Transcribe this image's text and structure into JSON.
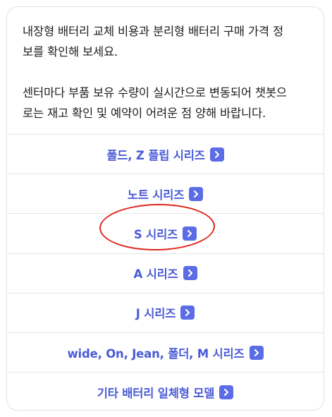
{
  "message": {
    "paragraph_1": "내장형 배터리 교체 비용과 분리형 배터리 구매 가격 정\n보를 확인해 보세요.",
    "paragraph_2": "센터마다 부품 보유 수량이 실시간으로 변동되어 챗봇으\n로는 재고 확인 및 예약이 어려운 점 양해 바랍니다."
  },
  "options": [
    {
      "label": "폴드, Z 플립 시리즈"
    },
    {
      "label": "노트 시리즈"
    },
    {
      "label": "S 시리즈"
    },
    {
      "label": "A 시리즈"
    },
    {
      "label": "J 시리즈"
    },
    {
      "label": "wide, On, Jean, 폴더, M 시리즈"
    },
    {
      "label": "기타 배터리 일체형 모델"
    }
  ],
  "icons": {
    "option_arrow": "chevron-right-icon"
  },
  "colors": {
    "option_text": "#4a5bd6",
    "arrow_badge": "#5b6ce6",
    "highlight_circle": "#e0261e"
  }
}
